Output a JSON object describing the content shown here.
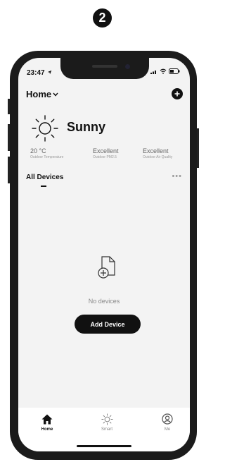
{
  "step_number": "2",
  "status_bar": {
    "time": "23:47"
  },
  "header": {
    "home_label": "Home"
  },
  "weather": {
    "condition": "Sunny",
    "metrics": [
      {
        "value": "20 °C",
        "label": "Outdoor Temperature"
      },
      {
        "value": "Excellent",
        "label": "Outdoor PM2.5"
      },
      {
        "value": "Excellent",
        "label": "Outdoor Air Quality"
      }
    ]
  },
  "tabs": {
    "active": "All Devices"
  },
  "empty_state": {
    "message": "No devices",
    "button": "Add Device"
  },
  "bottom_nav": {
    "items": [
      {
        "label": "Home",
        "icon": "home-icon",
        "active": true
      },
      {
        "label": "Smart",
        "icon": "sun-icon",
        "active": false
      },
      {
        "label": "Me",
        "icon": "profile-icon",
        "active": false
      }
    ]
  }
}
